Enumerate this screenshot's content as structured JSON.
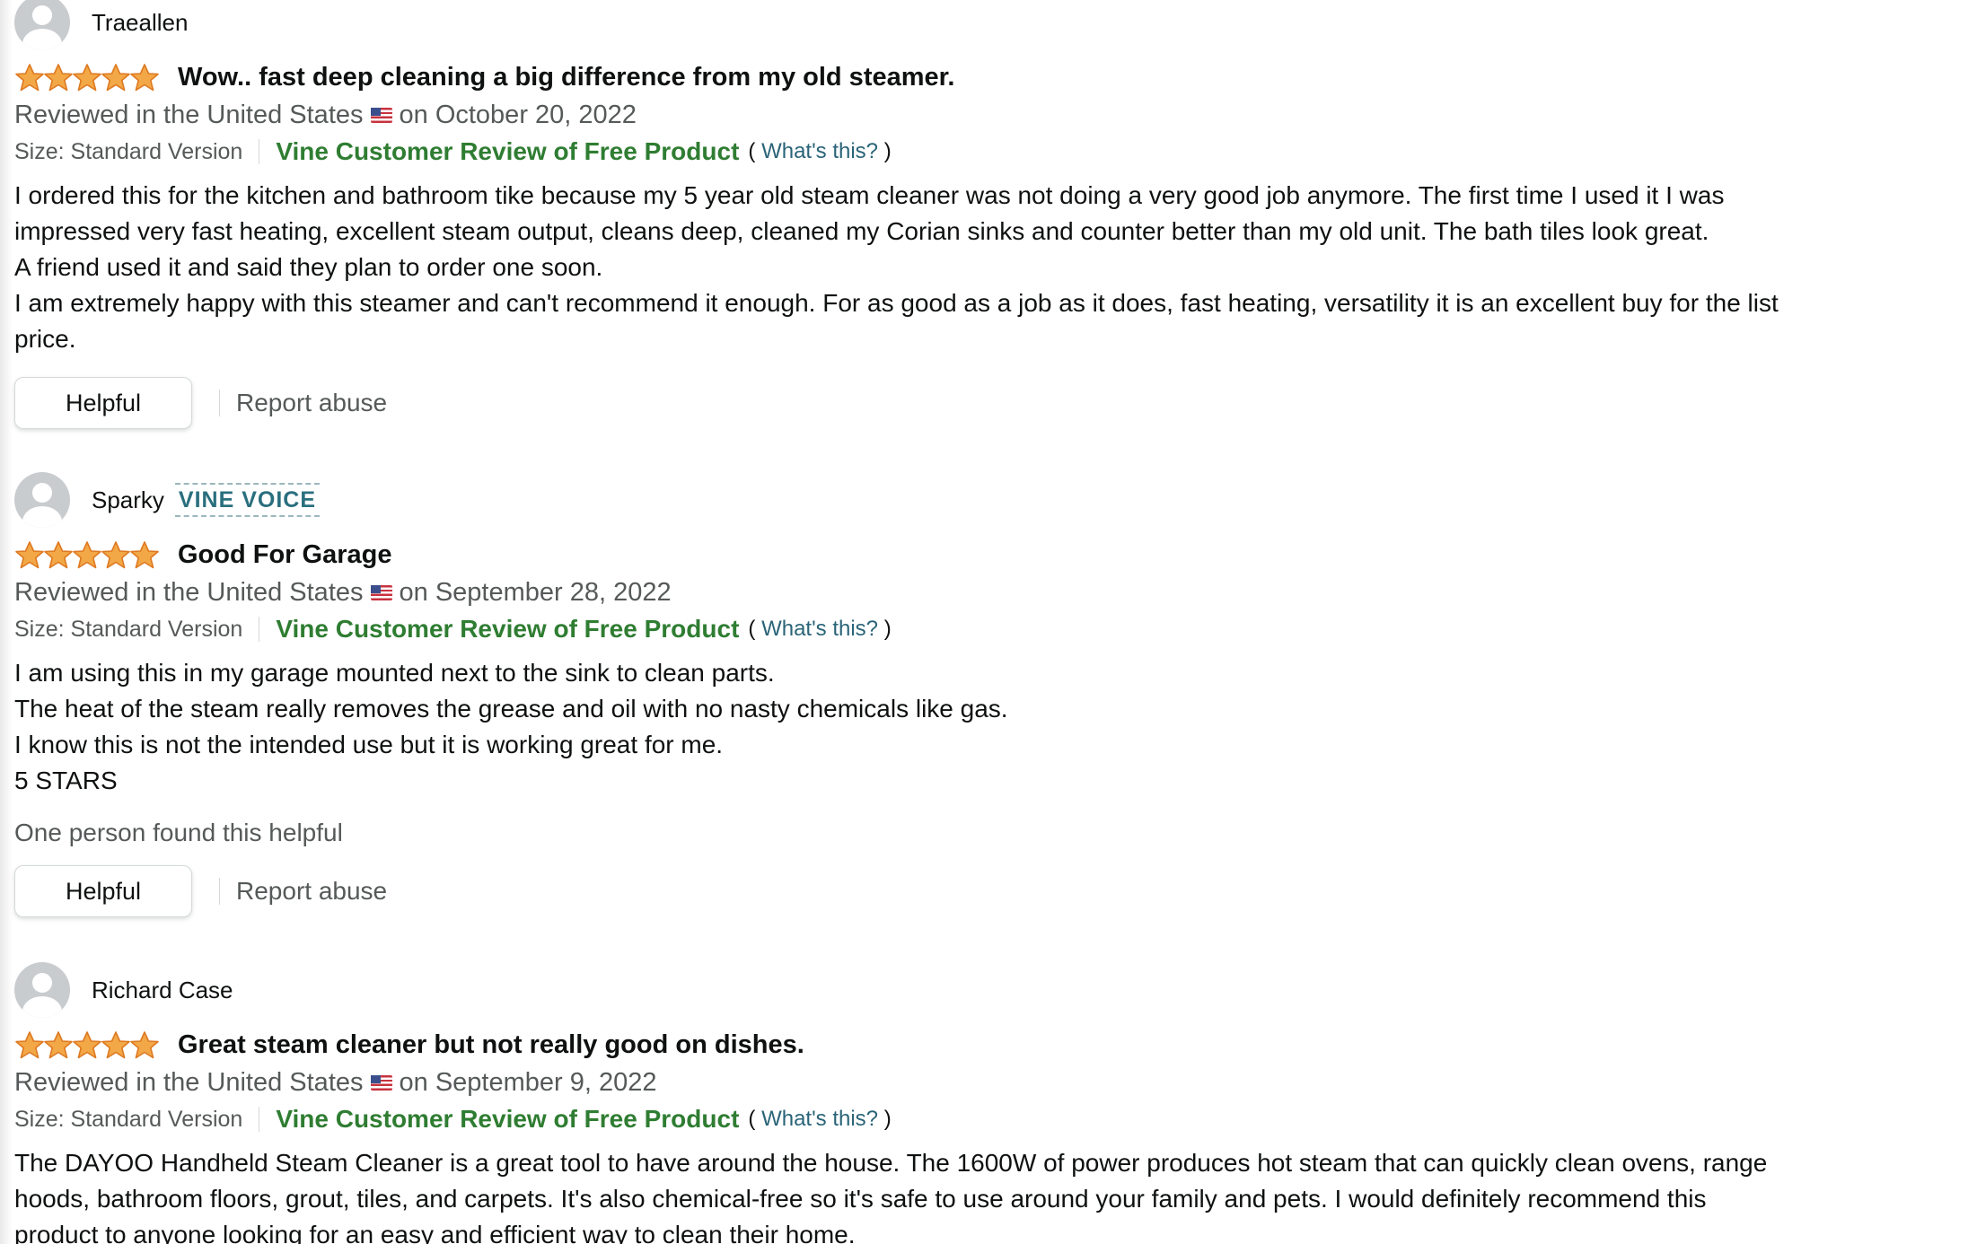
{
  "reviews": [
    {
      "reviewer": "Traeallen",
      "badge": "",
      "rating": 5,
      "title": "Wow.. fast deep cleaning a big difference from my old steamer.",
      "date_prefix": "Reviewed in the United States",
      "date_suffix": "on October 20, 2022",
      "format": "Size: Standard Version",
      "vine_label": "Vine Customer Review of Free Product",
      "whats_this": "What's this?",
      "body_lines": [
        "I ordered this for the kitchen and bathroom tike because my 5 year old steam cleaner was not doing a very good job anymore. The first time I used it I was",
        "impressed very fast heating, excellent steam output, cleans deep, cleaned my Corian sinks and counter better than my old unit. The bath tiles look great.",
        "A friend used it and said they plan to order one soon.",
        "I am extremely happy with this steamer and can't recommend it enough. For as good as a job as it does, fast heating, versatility it is an excellent buy for the list",
        "price."
      ],
      "helpful_count": "",
      "helpful_button": "Helpful",
      "report_link": "Report abuse"
    },
    {
      "reviewer": "Sparky",
      "badge": "VINE VOICE",
      "rating": 5,
      "title": "Good For Garage",
      "date_prefix": "Reviewed in the United States",
      "date_suffix": "on September 28, 2022",
      "format": "Size: Standard Version",
      "vine_label": "Vine Customer Review of Free Product",
      "whats_this": "What's this?",
      "body_lines": [
        "I am using this in my garage mounted next to the sink to clean parts.",
        "The heat of the steam really removes the grease and oil with no nasty chemicals like gas.",
        "I know this is not the intended use but it is working great for me.",
        "5 STARS"
      ],
      "helpful_count": "One person found this helpful",
      "helpful_button": "Helpful",
      "report_link": "Report abuse"
    },
    {
      "reviewer": "Richard Case",
      "badge": "",
      "rating": 5,
      "title": "Great steam cleaner but not really good on dishes.",
      "date_prefix": "Reviewed in the United States",
      "date_suffix": "on September 9, 2022",
      "format": "Size: Standard Version",
      "vine_label": "Vine Customer Review of Free Product",
      "whats_this": "What's this?",
      "body_lines": [
        "The DAYOO Handheld Steam Cleaner is a great tool to have around the house. The 1600W of power produces hot steam that can quickly clean ovens, range",
        "hoods, bathroom floors, grout, tiles, and carpets. It's also chemical-free so it's safe to use around your family and pets. I would definitely recommend this",
        "product to anyone looking for an easy and efficient way to clean their home."
      ],
      "helpful_count": "",
      "helpful_button": "",
      "report_link": ""
    }
  ],
  "icons": {
    "avatar": "avatar-icon",
    "star": "star-icon",
    "flag": "us-flag-icon"
  },
  "colors": {
    "star_fill": "#f3a847",
    "star_stroke": "#de7921",
    "vine_green": "#2f7d32",
    "vine_badge": "#2a6f7e",
    "link_teal": "#2a6478",
    "secondary_text": "#565959"
  }
}
